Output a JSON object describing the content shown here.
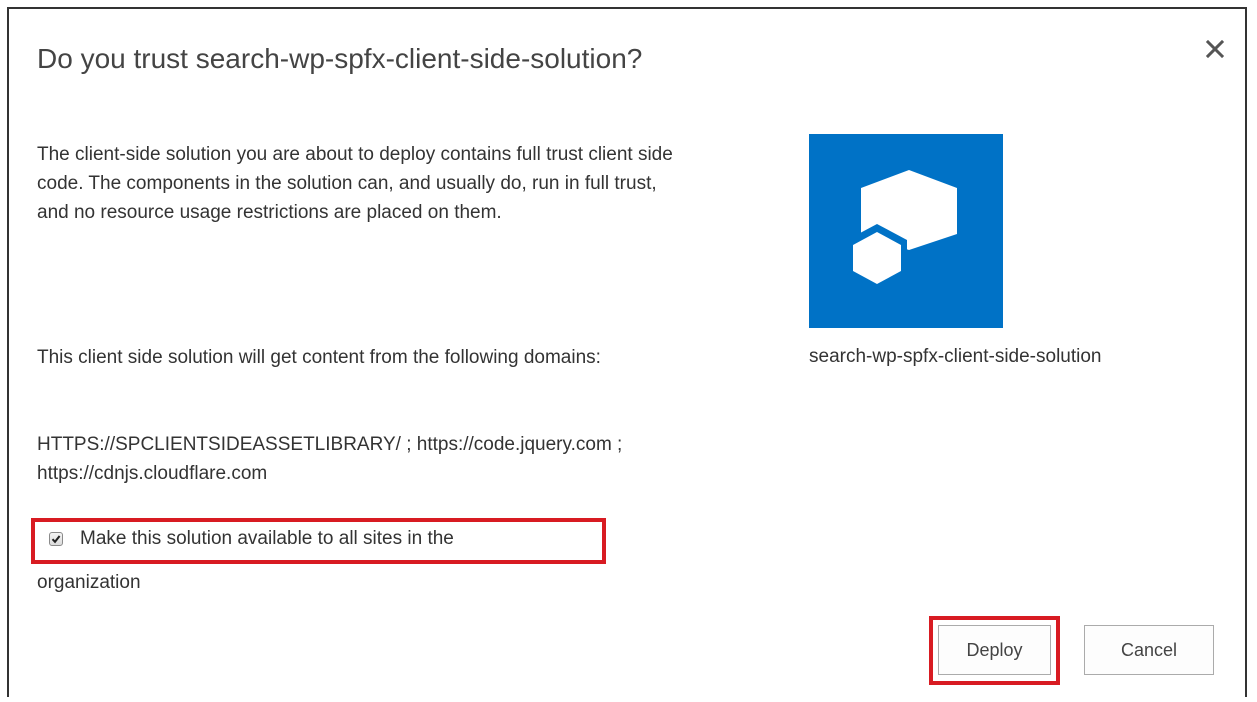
{
  "dialog": {
    "title": "Do you trust search-wp-spfx-client-side-solution?",
    "close_icon": "close-icon",
    "description": "The client-side solution you are about to deploy contains full trust client side code. The components in the solution can, and usually do, run in full trust, and no resource usage restrictions are placed on them.",
    "domains_intro": "This client side solution will get content from the following domains:",
    "domains": "HTTPS://SPCLIENTSIDEASSETLIBRARY/ ; https://code.jquery.com ; https://cdnjs.cloudflare.com",
    "tenant_checkbox": {
      "checked": true,
      "label_line1": "Make this solution available to all sites in the",
      "label_line2": "organization"
    },
    "solution": {
      "icon": "sharepoint-app-icon",
      "name": "search-wp-spfx-client-side-solution"
    },
    "buttons": {
      "deploy_label": "Deploy",
      "cancel_label": "Cancel"
    }
  },
  "colors": {
    "accent_tile": "#0072c6",
    "highlight": "#d81b22"
  }
}
